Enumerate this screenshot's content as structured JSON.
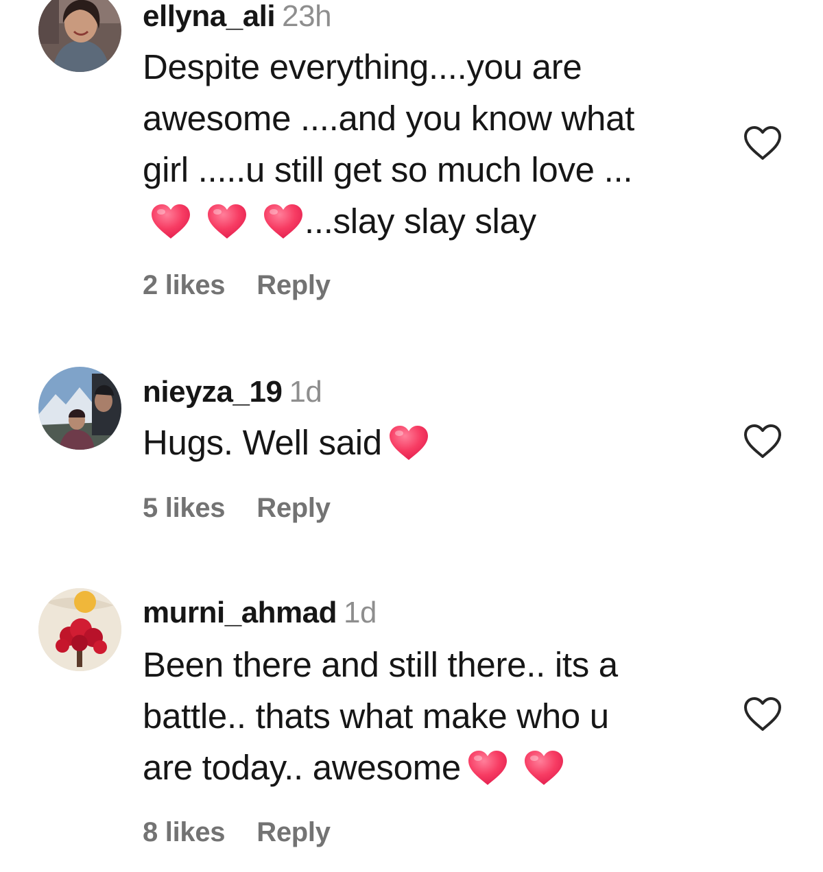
{
  "comments": [
    {
      "username": "ellyna_ali",
      "time": "23h",
      "lines": [
        "Despite everything....you are",
        "awesome ....and you know what",
        "girl .....u still get so much love ..."
      ],
      "last_line_suffix": "...slay slay slay",
      "last_line_emoji_count": 3,
      "likes": "2 likes",
      "reply": "Reply",
      "avatar_icon": "profile-photo-woman",
      "like_icon": "heart-outline-icon"
    },
    {
      "username": "nieyza_19",
      "time": "1d",
      "text": "Hugs. Well said",
      "emoji_count": 1,
      "likes": "5 likes",
      "reply": "Reply",
      "avatar_icon": "profile-photo-couple-mountains",
      "like_icon": "heart-outline-icon"
    },
    {
      "username": "murni_ahmad",
      "time": "1d",
      "lines": [
        "Been there and still there.. its a",
        "battle.. thats what make who u"
      ],
      "last_line_prefix": "are today.. awesome",
      "last_line_emoji_count": 2,
      "likes": "8 likes",
      "reply": "Reply",
      "avatar_icon": "profile-photo-red-tree-sun",
      "like_icon": "heart-outline-icon"
    }
  ],
  "colors": {
    "text": "#161616",
    "muted": "#8e8e8e",
    "footer": "#737373",
    "heart_emoji": "#f0335a",
    "heart_outline": "#262626"
  }
}
